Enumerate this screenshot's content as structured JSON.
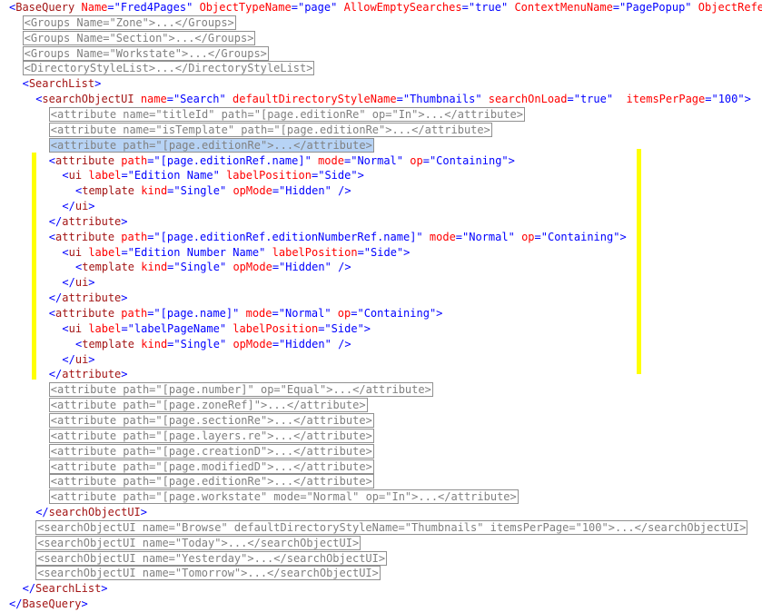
{
  "lines": [
    {
      "indent": 0,
      "tokens": [
        [
          "p",
          "<"
        ],
        [
          "t",
          "BaseQuery"
        ],
        [
          "s",
          " "
        ],
        [
          "a",
          "Name"
        ],
        [
          "p",
          "=\""
        ],
        [
          "v",
          "Fred4Pages"
        ],
        [
          "p",
          "\""
        ],
        [
          "s",
          " "
        ],
        [
          "a",
          "ObjectTypeName"
        ],
        [
          "p",
          "=\""
        ],
        [
          "v",
          "page"
        ],
        [
          "p",
          "\""
        ],
        [
          "s",
          " "
        ],
        [
          "a",
          "AllowEmptySearches"
        ],
        [
          "p",
          "=\""
        ],
        [
          "v",
          "true"
        ],
        [
          "p",
          "\""
        ],
        [
          "s",
          " "
        ],
        [
          "a",
          "ContextMenuName"
        ],
        [
          "p",
          "=\""
        ],
        [
          "v",
          "PagePopup"
        ],
        [
          "p",
          "\""
        ],
        [
          "s",
          " "
        ],
        [
          "a",
          "ObjectRefere"
        ]
      ]
    },
    {
      "indent": 2,
      "collapsed": true,
      "text": "<Groups Name=\"Zone\">...</Groups>"
    },
    {
      "indent": 2,
      "collapsed": true,
      "text": "<Groups Name=\"Section\">...</Groups>"
    },
    {
      "indent": 2,
      "collapsed": true,
      "text": "<Groups Name=\"Workstate\">...</Groups>"
    },
    {
      "indent": 2,
      "collapsed": true,
      "text": "<DirectoryStyleList>...</DirectoryStyleList>"
    },
    {
      "indent": 2,
      "tokens": [
        [
          "p",
          "<"
        ],
        [
          "t",
          "SearchList"
        ],
        [
          "p",
          ">"
        ]
      ]
    },
    {
      "indent": 4,
      "tokens": [
        [
          "p",
          "<"
        ],
        [
          "t",
          "searchObjectUI"
        ],
        [
          "s",
          " "
        ],
        [
          "a",
          "name"
        ],
        [
          "p",
          "=\""
        ],
        [
          "v",
          "Search"
        ],
        [
          "p",
          "\""
        ],
        [
          "s",
          " "
        ],
        [
          "a",
          "defaultDirectoryStyleName"
        ],
        [
          "p",
          "=\""
        ],
        [
          "v",
          "Thumbnails"
        ],
        [
          "p",
          "\""
        ],
        [
          "s",
          " "
        ],
        [
          "a",
          "searchOnLoad"
        ],
        [
          "p",
          "=\""
        ],
        [
          "v",
          "true"
        ],
        [
          "p",
          "\""
        ],
        [
          "s",
          "  "
        ],
        [
          "a",
          "itemsPerPage"
        ],
        [
          "p",
          "=\""
        ],
        [
          "v",
          "100"
        ],
        [
          "p",
          "\">"
        ]
      ]
    },
    {
      "indent": 6,
      "collapsed": true,
      "text": "<attribute name=\"titleId\" path=\"[page.editionRe\" op=\"In\">...</attribute>"
    },
    {
      "indent": 6,
      "collapsed": true,
      "text": "<attribute name=\"isTemplate\" path=\"[page.editionRe\">...</attribute>"
    },
    {
      "indent": 6,
      "collapsed": true,
      "selected": true,
      "text": "<attribute path=\"[page.editionRe\">...</attribute>"
    },
    {
      "indent": 6,
      "tokens": [
        [
          "p",
          "<"
        ],
        [
          "t",
          "attribute"
        ],
        [
          "s",
          " "
        ],
        [
          "a",
          "path"
        ],
        [
          "p",
          "=\""
        ],
        [
          "v",
          "[page.editionRef.name]"
        ],
        [
          "p",
          "\""
        ],
        [
          "s",
          " "
        ],
        [
          "a",
          "mode"
        ],
        [
          "p",
          "=\""
        ],
        [
          "v",
          "Normal"
        ],
        [
          "p",
          "\""
        ],
        [
          "s",
          " "
        ],
        [
          "a",
          "op"
        ],
        [
          "p",
          "=\""
        ],
        [
          "v",
          "Containing"
        ],
        [
          "p",
          "\">"
        ]
      ]
    },
    {
      "indent": 8,
      "tokens": [
        [
          "p",
          "<"
        ],
        [
          "t",
          "ui"
        ],
        [
          "s",
          " "
        ],
        [
          "a",
          "label"
        ],
        [
          "p",
          "=\""
        ],
        [
          "v",
          "Edition Name"
        ],
        [
          "p",
          "\""
        ],
        [
          "s",
          " "
        ],
        [
          "a",
          "labelPosition"
        ],
        [
          "p",
          "=\""
        ],
        [
          "v",
          "Side"
        ],
        [
          "p",
          "\">"
        ]
      ]
    },
    {
      "indent": 10,
      "tokens": [
        [
          "p",
          "<"
        ],
        [
          "t",
          "template"
        ],
        [
          "s",
          " "
        ],
        [
          "a",
          "kind"
        ],
        [
          "p",
          "=\""
        ],
        [
          "v",
          "Single"
        ],
        [
          "p",
          "\""
        ],
        [
          "s",
          " "
        ],
        [
          "a",
          "opMode"
        ],
        [
          "p",
          "=\""
        ],
        [
          "v",
          "Hidden"
        ],
        [
          "p",
          "\""
        ],
        [
          "s",
          " "
        ],
        [
          "p",
          "/>"
        ]
      ]
    },
    {
      "indent": 8,
      "tokens": [
        [
          "p",
          "</"
        ],
        [
          "t",
          "ui"
        ],
        [
          "p",
          ">"
        ]
      ]
    },
    {
      "indent": 6,
      "tokens": [
        [
          "p",
          "</"
        ],
        [
          "t",
          "attribute"
        ],
        [
          "p",
          ">"
        ]
      ]
    },
    {
      "indent": 6,
      "tokens": [
        [
          "p",
          "<"
        ],
        [
          "t",
          "attribute"
        ],
        [
          "s",
          " "
        ],
        [
          "a",
          "path"
        ],
        [
          "p",
          "=\""
        ],
        [
          "v",
          "[page.editionRef.editionNumberRef.name]"
        ],
        [
          "p",
          "\""
        ],
        [
          "s",
          " "
        ],
        [
          "a",
          "mode"
        ],
        [
          "p",
          "=\""
        ],
        [
          "v",
          "Normal"
        ],
        [
          "p",
          "\""
        ],
        [
          "s",
          " "
        ],
        [
          "a",
          "op"
        ],
        [
          "p",
          "=\""
        ],
        [
          "v",
          "Containing"
        ],
        [
          "p",
          "\">"
        ]
      ]
    },
    {
      "indent": 8,
      "tokens": [
        [
          "p",
          "<"
        ],
        [
          "t",
          "ui"
        ],
        [
          "s",
          " "
        ],
        [
          "a",
          "label"
        ],
        [
          "p",
          "=\""
        ],
        [
          "v",
          "Edition Number Name"
        ],
        [
          "p",
          "\""
        ],
        [
          "s",
          " "
        ],
        [
          "a",
          "labelPosition"
        ],
        [
          "p",
          "=\""
        ],
        [
          "v",
          "Side"
        ],
        [
          "p",
          "\">"
        ]
      ]
    },
    {
      "indent": 10,
      "tokens": [
        [
          "p",
          "<"
        ],
        [
          "t",
          "template"
        ],
        [
          "s",
          " "
        ],
        [
          "a",
          "kind"
        ],
        [
          "p",
          "=\""
        ],
        [
          "v",
          "Single"
        ],
        [
          "p",
          "\""
        ],
        [
          "s",
          " "
        ],
        [
          "a",
          "opMode"
        ],
        [
          "p",
          "=\""
        ],
        [
          "v",
          "Hidden"
        ],
        [
          "p",
          "\""
        ],
        [
          "s",
          " "
        ],
        [
          "p",
          "/>"
        ]
      ]
    },
    {
      "indent": 8,
      "tokens": [
        [
          "p",
          "</"
        ],
        [
          "t",
          "ui"
        ],
        [
          "p",
          ">"
        ]
      ]
    },
    {
      "indent": 6,
      "tokens": [
        [
          "p",
          "</"
        ],
        [
          "t",
          "attribute"
        ],
        [
          "p",
          ">"
        ]
      ]
    },
    {
      "indent": 6,
      "tokens": [
        [
          "p",
          "<"
        ],
        [
          "t",
          "attribute"
        ],
        [
          "s",
          " "
        ],
        [
          "a",
          "path"
        ],
        [
          "p",
          "=\""
        ],
        [
          "v",
          "[page.name]"
        ],
        [
          "p",
          "\""
        ],
        [
          "s",
          " "
        ],
        [
          "a",
          "mode"
        ],
        [
          "p",
          "=\""
        ],
        [
          "v",
          "Normal"
        ],
        [
          "p",
          "\""
        ],
        [
          "s",
          " "
        ],
        [
          "a",
          "op"
        ],
        [
          "p",
          "=\""
        ],
        [
          "v",
          "Containing"
        ],
        [
          "p",
          "\">"
        ]
      ]
    },
    {
      "indent": 8,
      "tokens": [
        [
          "p",
          "<"
        ],
        [
          "t",
          "ui"
        ],
        [
          "s",
          " "
        ],
        [
          "a",
          "label"
        ],
        [
          "p",
          "=\""
        ],
        [
          "v",
          "labelPageName"
        ],
        [
          "p",
          "\""
        ],
        [
          "s",
          " "
        ],
        [
          "a",
          "labelPosition"
        ],
        [
          "p",
          "=\""
        ],
        [
          "v",
          "Side"
        ],
        [
          "p",
          "\">"
        ]
      ]
    },
    {
      "indent": 10,
      "tokens": [
        [
          "p",
          "<"
        ],
        [
          "t",
          "template"
        ],
        [
          "s",
          " "
        ],
        [
          "a",
          "kind"
        ],
        [
          "p",
          "=\""
        ],
        [
          "v",
          "Single"
        ],
        [
          "p",
          "\""
        ],
        [
          "s",
          " "
        ],
        [
          "a",
          "opMode"
        ],
        [
          "p",
          "=\""
        ],
        [
          "v",
          "Hidden"
        ],
        [
          "p",
          "\""
        ],
        [
          "s",
          " "
        ],
        [
          "p",
          "/>"
        ]
      ]
    },
    {
      "indent": 8,
      "tokens": [
        [
          "p",
          "</"
        ],
        [
          "t",
          "ui"
        ],
        [
          "p",
          ">"
        ]
      ]
    },
    {
      "indent": 6,
      "tokens": [
        [
          "p",
          "</"
        ],
        [
          "t",
          "attribute"
        ],
        [
          "p",
          ">"
        ]
      ]
    },
    {
      "indent": 6,
      "collapsed": true,
      "text": "<attribute path=\"[page.number]\" op=\"Equal\">...</attribute>"
    },
    {
      "indent": 6,
      "collapsed": true,
      "text": "<attribute path=\"[page.zoneRef]\">...</attribute>"
    },
    {
      "indent": 6,
      "collapsed": true,
      "text": "<attribute path=\"[page.sectionRe\">...</attribute>"
    },
    {
      "indent": 6,
      "collapsed": true,
      "text": "<attribute path=\"[page.layers.re\">...</attribute>"
    },
    {
      "indent": 6,
      "collapsed": true,
      "text": "<attribute path=\"[page.creationD\">...</attribute>"
    },
    {
      "indent": 6,
      "collapsed": true,
      "text": "<attribute path=\"[page.modifiedD\">...</attribute>"
    },
    {
      "indent": 6,
      "collapsed": true,
      "text": "<attribute path=\"[page.editionRe\">...</attribute>"
    },
    {
      "indent": 6,
      "collapsed": true,
      "text": "<attribute path=\"[page.workstate\" mode=\"Normal\" op=\"In\">...</attribute>"
    },
    {
      "indent": 4,
      "tokens": [
        [
          "p",
          "</"
        ],
        [
          "t",
          "searchObjectUI"
        ],
        [
          "p",
          ">"
        ]
      ]
    },
    {
      "indent": 4,
      "collapsed": true,
      "text": "<searchObjectUI name=\"Browse\" defaultDirectoryStyleName=\"Thumbnails\" itemsPerPage=\"100\">...</searchObjectUI>"
    },
    {
      "indent": 4,
      "collapsed": true,
      "text": "<searchObjectUI name=\"Today\">...</searchObjectUI>"
    },
    {
      "indent": 4,
      "collapsed": true,
      "text": "<searchObjectUI name=\"Yesterday\">...</searchObjectUI>"
    },
    {
      "indent": 4,
      "collapsed": true,
      "text": "<searchObjectUI name=\"Tomorrow\">...</searchObjectUI>"
    },
    {
      "indent": 2,
      "tokens": [
        [
          "p",
          "</"
        ],
        [
          "t",
          "SearchList"
        ],
        [
          "p",
          ">"
        ]
      ]
    },
    {
      "indent": 0,
      "tokens": [
        [
          "p",
          "</"
        ],
        [
          "t",
          "BaseQuery"
        ],
        [
          "p",
          ">"
        ]
      ]
    }
  ],
  "colors": {
    "tag": "#a31515",
    "punct": "#0000ff",
    "attr": "#ff0000",
    "value": "#0000ff",
    "collapsed": "#808080",
    "selection": "#b7d3f5",
    "marker": "#ffff00"
  }
}
